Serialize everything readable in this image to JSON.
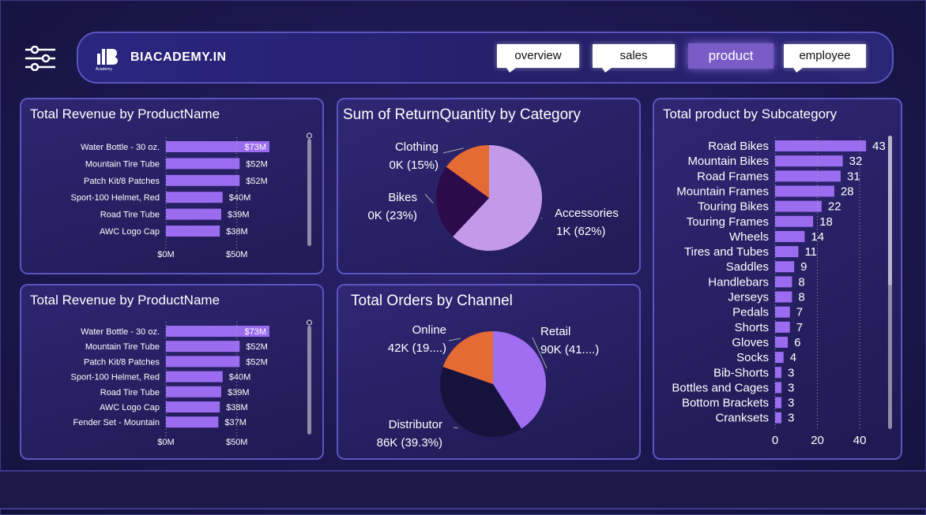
{
  "header": {
    "brand": "BIACADEMY.IN",
    "logo_subtext": "Academy",
    "tabs": [
      {
        "label": "overview",
        "active": false
      },
      {
        "label": "sales",
        "active": false
      },
      {
        "label": "product",
        "active": true
      },
      {
        "label": "employee",
        "active": false
      }
    ]
  },
  "colors": {
    "bar": "#9b6cf0",
    "pie_purple_light": "#c39ae8",
    "pie_dark": "#2d0a4a",
    "pie_orange": "#e46b34",
    "pie_purple": "#a06ef0",
    "pie_navy": "#16123c"
  },
  "chart_data": [
    {
      "id": "revenue1",
      "type": "bar",
      "orientation": "horizontal",
      "title": "Total Revenue by ProductName",
      "categories": [
        "Water Bottle - 30 oz.",
        "Mountain Tire Tube",
        "Patch Kit/8 Patches",
        "Sport-100 Helmet, Red",
        "Road Tire Tube",
        "AWC Logo Cap"
      ],
      "values": [
        73,
        52,
        52,
        40,
        39,
        38
      ],
      "labels": [
        "$73M",
        "$52M",
        "$52M",
        "$40M",
        "$39M",
        "$38M"
      ],
      "xlim": [
        0,
        73
      ],
      "xticks": [
        "$0M",
        "$50M"
      ],
      "xtick_values": [
        0,
        50
      ]
    },
    {
      "id": "revenue2",
      "type": "bar",
      "orientation": "horizontal",
      "title": "Total Revenue by ProductName",
      "categories": [
        "Water Bottle - 30 oz.",
        "Mountain Tire Tube",
        "Patch Kit/8 Patches",
        "Sport-100 Helmet, Red",
        "Road Tire Tube",
        "AWC Logo Cap",
        "Fender Set - Mountain"
      ],
      "values": [
        73,
        52,
        52,
        40,
        39,
        38,
        37
      ],
      "labels": [
        "$73M",
        "$52M",
        "$52M",
        "$40M",
        "$39M",
        "$38M",
        "$37M"
      ],
      "xlim": [
        0,
        73
      ],
      "xticks": [
        "$0M",
        "$50M"
      ],
      "xtick_values": [
        0,
        50
      ]
    },
    {
      "id": "returns",
      "type": "pie",
      "title": "Sum of ReturnQuantity by Category",
      "slices": [
        {
          "name": "Accessories",
          "value": 62,
          "label": "1K (62%)",
          "color": "#c39ae8"
        },
        {
          "name": "Bikes",
          "value": 23,
          "label": "0K (23%)",
          "color": "#2d0a4a"
        },
        {
          "name": "Clothing",
          "value": 15,
          "label": "0K (15%)",
          "color": "#e46b34"
        }
      ]
    },
    {
      "id": "orders",
      "type": "pie",
      "title": "Total Orders by Channel",
      "slices": [
        {
          "name": "Retail",
          "value": 41,
          "label": "90K (41....)",
          "color": "#a06ef0"
        },
        {
          "name": "Distributor",
          "value": 39.3,
          "label": "86K (39.3%)",
          "color": "#16123c"
        },
        {
          "name": "Online",
          "value": 19.7,
          "label": "42K (19....)",
          "color": "#e46b34"
        }
      ]
    },
    {
      "id": "subcat",
      "type": "bar",
      "orientation": "horizontal",
      "title": "Total product by Subcategory",
      "categories": [
        "Road Bikes",
        "Mountain Bikes",
        "Road Frames",
        "Mountain Frames",
        "Touring Bikes",
        "Touring Frames",
        "Wheels",
        "Tires and Tubes",
        "Saddles",
        "Handlebars",
        "Jerseys",
        "Pedals",
        "Shorts",
        "Gloves",
        "Socks",
        "Bib-Shorts",
        "Bottles and Cages",
        "Bottom Brackets",
        "Cranksets"
      ],
      "values": [
        43,
        32,
        31,
        28,
        22,
        18,
        14,
        11,
        9,
        8,
        8,
        7,
        7,
        6,
        4,
        3,
        3,
        3,
        3
      ],
      "xlim": [
        0,
        48
      ],
      "xticks": [
        "0",
        "20",
        "40"
      ],
      "xtick_values": [
        0,
        20,
        40
      ]
    }
  ]
}
